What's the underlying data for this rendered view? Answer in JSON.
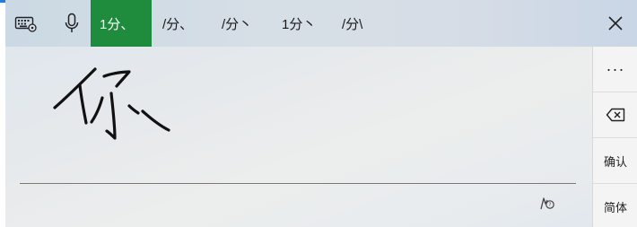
{
  "toolbar": {
    "keyboard_icon": "keyboard-settings-icon",
    "mic_icon": "microphone-icon",
    "close_icon": "close-icon",
    "candidates": [
      {
        "text": "1分、",
        "selected": true
      },
      {
        "text": "/分、",
        "selected": false
      },
      {
        "text": "/分丶",
        "selected": false
      },
      {
        "text": "1分丶",
        "selected": false
      },
      {
        "text": "/分\\",
        "selected": false
      }
    ]
  },
  "canvas": {
    "ink_color": "#111111",
    "handwriting_help_icon": "handwriting-help-icon"
  },
  "side_buttons": {
    "more_label": "···",
    "backspace_icon": "backspace-icon",
    "confirm_label": "确认",
    "simplified_label": "简体"
  },
  "colors": {
    "selected_candidate": "#1e8c3c"
  }
}
